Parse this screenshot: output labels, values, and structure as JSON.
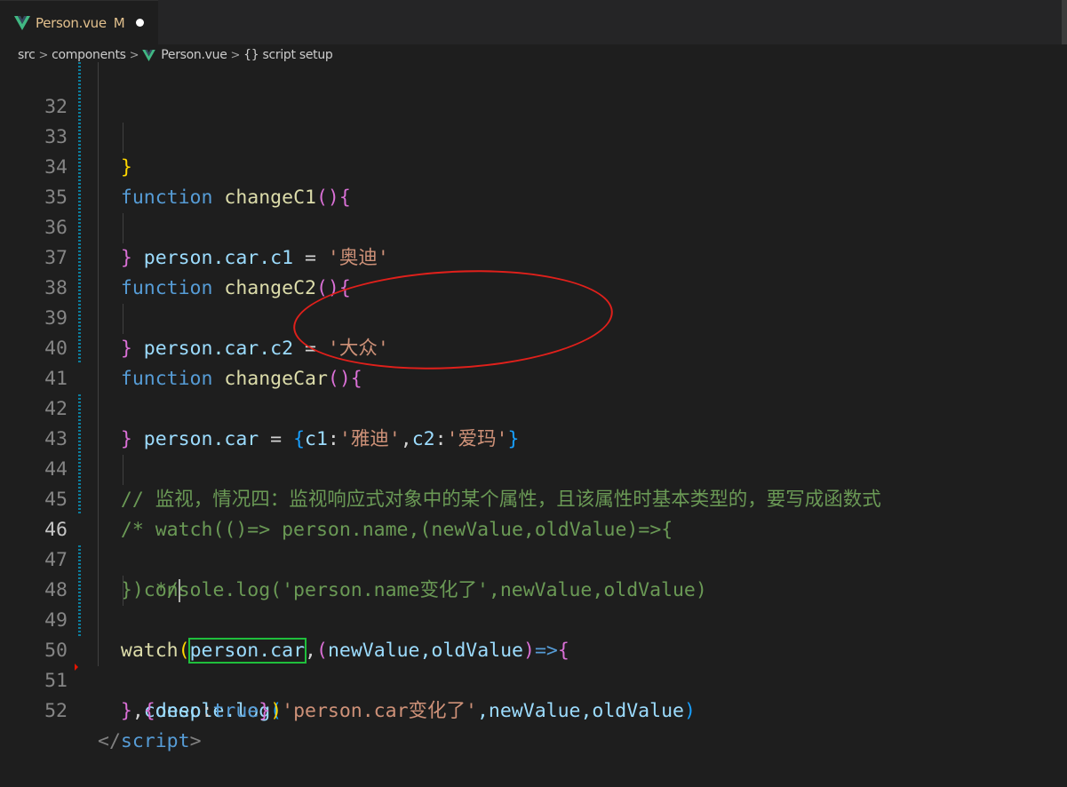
{
  "tab": {
    "file_name": "Person.vue",
    "status": "M",
    "icon": "vue-icon"
  },
  "breadcrumb": {
    "items": [
      "src",
      "components",
      "Person.vue",
      "{} script setup"
    ]
  },
  "editor": {
    "active_line": "46",
    "lines": [
      {
        "num": "32"
      },
      {
        "num": "33"
      },
      {
        "num": "34"
      },
      {
        "num": "35"
      },
      {
        "num": "36"
      },
      {
        "num": "37"
      },
      {
        "num": "38"
      },
      {
        "num": "39"
      },
      {
        "num": "40"
      },
      {
        "num": "41"
      },
      {
        "num": "42"
      },
      {
        "num": "43"
      },
      {
        "num": "44"
      },
      {
        "num": "45"
      },
      {
        "num": "46"
      },
      {
        "num": "47"
      },
      {
        "num": "48"
      },
      {
        "num": "49"
      },
      {
        "num": "50"
      },
      {
        "num": "51"
      },
      {
        "num": "52"
      }
    ],
    "tokens": {
      "l32": "}",
      "kw_function": "function",
      "fn_c1": "changeC1",
      "fn_c2": "changeC2",
      "fn_car": "changeCar",
      "paren_open": "()",
      "brace_open": "{",
      "brace_close": "}",
      "person_car_c1": "person.car.c1",
      "person_car_c2": "person.car.c2",
      "person_car": "person.car",
      "eq": " = ",
      "str_aodi": "'奥迪'",
      "str_dazhong": "'大众'",
      "obj_open": "{",
      "key_c1": "c1",
      "colon": ":",
      "str_yadi": "'雅迪'",
      "comma": ",",
      "key_c2": "c2",
      "str_aima": "'爱玛'",
      "obj_close": "}",
      "comment_43": "// 监视，情况四：监视响应式对象中的某个属性，且该属性时基本类型的，要写成函数式",
      "comment_44": "/* watch(()=> person.name,(newValue,oldValue)=>{",
      "comment_45": "console.log('person.name变化了',newValue,oldValue)",
      "comment_46": "}) */",
      "watch": "watch",
      "watch_target": "person.car",
      "watch_args_params": "newValue,oldValue",
      "arrow": "=>",
      "console_log": "console.log",
      "log_str": "'person.car变化了'",
      "log_args": ",newValue,oldValue",
      "deep_key": "deep",
      "deep_val": "true",
      "close_script_lt": "</",
      "close_script_tag": "script",
      "close_script_gt": ">"
    }
  },
  "annotation": {
    "ellipse_color": "#e0201b",
    "box_color": "#1fbf3c"
  }
}
